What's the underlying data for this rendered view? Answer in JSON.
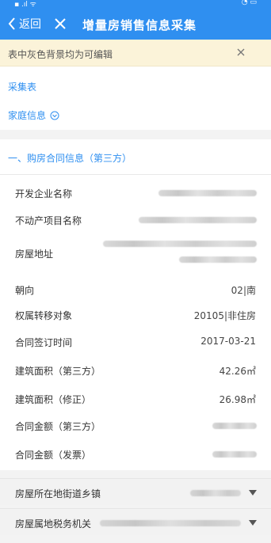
{
  "header": {
    "back_label": "返回",
    "title": "增量房销售信息采集"
  },
  "notice": {
    "text": "表中灰色背景均为可编辑"
  },
  "links": {
    "collect_table": "采集表",
    "family_info": "家庭信息"
  },
  "section": {
    "title": "一、购房合同信息（第三方）",
    "rows": [
      {
        "label": "开发企业名称",
        "value": ""
      },
      {
        "label": "不动产项目名称",
        "value": ""
      },
      {
        "label": "房屋地址",
        "value": ""
      },
      {
        "label": "朝向",
        "value": "02|南"
      },
      {
        "label": "权属转移对象",
        "value": "20105|非住房"
      },
      {
        "label": "合同签订时间",
        "value": "2017-03-21"
      },
      {
        "label": "建筑面积（第三方）",
        "value": "42.26㎡"
      },
      {
        "label": "建筑面积（修正）",
        "value": "26.98㎡"
      },
      {
        "label": "合同金额（第三方）",
        "value": ""
      },
      {
        "label": "合同金额（发票）",
        "value": ""
      }
    ]
  },
  "selects": [
    {
      "label": "房屋所在地街道乡镇"
    },
    {
      "label": "房屋属地税务机关"
    }
  ],
  "colors": {
    "accent": "#2f8ff0",
    "notice_bg": "#fbf3d9"
  }
}
